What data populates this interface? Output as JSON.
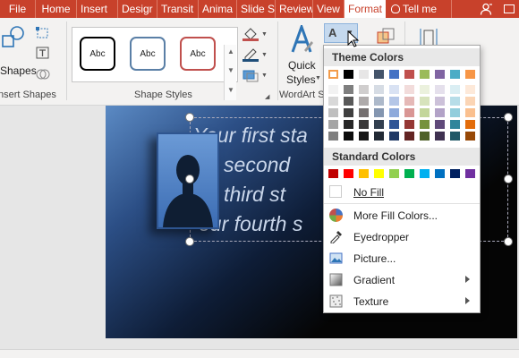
{
  "tabs": [
    "File",
    "Home",
    "Insert",
    "Desigr",
    "Transit",
    "Anima",
    "Slide S",
    "Review",
    "View",
    "Format"
  ],
  "tell_me": "Tell me",
  "ribbon": {
    "shapes_label": "Shapes",
    "insert_shapes_label": "nsert Shapes",
    "shape_styles_label": "Shape Styles",
    "style_sample": "Abc",
    "quick_styles_line1": "Quick",
    "quick_styles_line2": "Styles",
    "wordart_label": "WordArt S",
    "text_fill_letter": "A"
  },
  "slide": {
    "lines": [
      "Your first sta",
      "r second",
      "r third st",
      "our fourth s"
    ]
  },
  "menu": {
    "theme_colors_label": "Theme Colors",
    "standard_colors_label": "Standard Colors",
    "no_fill": "No Fill",
    "more_fill_colors": "More Fill Colors...",
    "eyedropper": "Eyedropper",
    "picture": "Picture...",
    "gradient": "Gradient",
    "texture": "Texture"
  },
  "colors": {
    "accent": "#c8412b",
    "theme_top": [
      "#ffffff",
      "#000000",
      "#e7e6e6",
      "#44546a",
      "#4472c4",
      "#c0504d",
      "#9bbb59",
      "#8064a2",
      "#4bacc6",
      "#f79646"
    ],
    "theme_shades": [
      [
        "#f2f2f2",
        "#7f7f7f",
        "#d0cece",
        "#d6dce4",
        "#d9e2f3",
        "#f2dcdb",
        "#ebf1dd",
        "#e5e0ec",
        "#daeef3",
        "#fde9d9"
      ],
      [
        "#d8d8d8",
        "#595959",
        "#aeaaaa",
        "#adb9ca",
        "#b4c6e7",
        "#e5b9b7",
        "#d7e3bc",
        "#ccc1d9",
        "#b7dde8",
        "#fbd5b5"
      ],
      [
        "#bfbfbf",
        "#3f3f3f",
        "#757070",
        "#8496b0",
        "#8eaadb",
        "#d99694",
        "#c3d69b",
        "#b2a2c7",
        "#92cddc",
        "#fac08f"
      ],
      [
        "#a5a5a5",
        "#262626",
        "#3a3838",
        "#323f4f",
        "#2f5496",
        "#953734",
        "#76923c",
        "#5f497a",
        "#31859b",
        "#e36c09"
      ],
      [
        "#7f7f7f",
        "#0c0c0c",
        "#171616",
        "#222a35",
        "#1f3864",
        "#632423",
        "#4f6128",
        "#3f3151",
        "#205867",
        "#974806"
      ]
    ],
    "standard": [
      "#c00000",
      "#ff0000",
      "#ffc000",
      "#ffff00",
      "#92d050",
      "#00b050",
      "#00b0f0",
      "#0070c0",
      "#002060",
      "#7030a0"
    ]
  },
  "icons": [
    "shapes-icon",
    "edit-shape-icon",
    "textbox-icon",
    "merge-shapes-icon",
    "shape-fill-icon",
    "shape-outline-icon",
    "shape-effects-icon",
    "quick-styles-icon",
    "text-fill-icon",
    "arrange-icon",
    "size-icon",
    "lightbulb-icon",
    "user-icon",
    "restore-icon",
    "more-colors-icon",
    "eyedropper-icon",
    "picture-icon",
    "gradient-icon",
    "texture-icon",
    "cursor-icon"
  ]
}
